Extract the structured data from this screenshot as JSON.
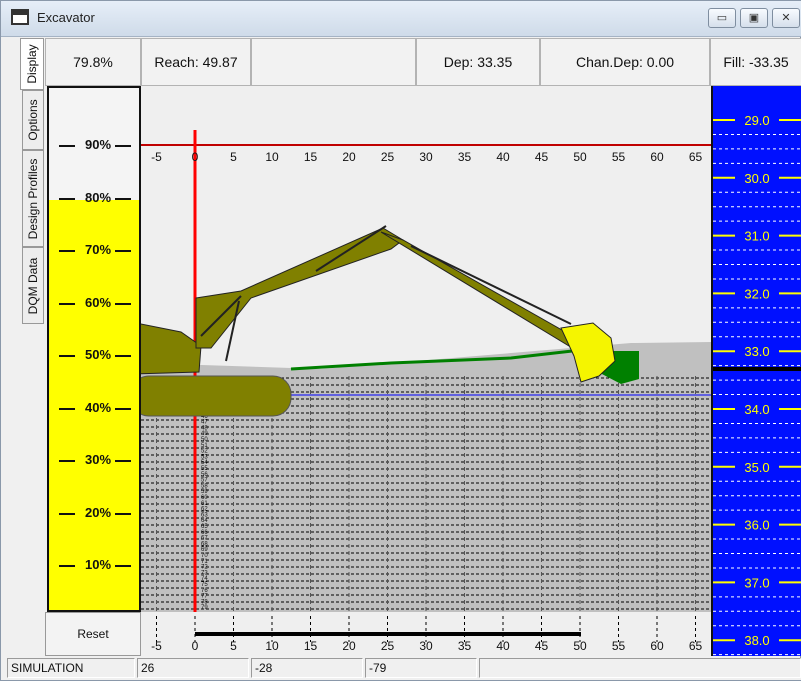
{
  "window": {
    "title": "Excavator",
    "minimize": "▭",
    "maximize": "▣",
    "close": "✕"
  },
  "tabs": [
    {
      "label": "Display",
      "active": true
    },
    {
      "label": "Options",
      "active": false
    },
    {
      "label": "Design Profiles",
      "active": false
    },
    {
      "label": "DQM Data",
      "active": false
    }
  ],
  "header": {
    "percent": "79.8%",
    "reach": "Reach: 49.87",
    "dep": "Dep: 33.35",
    "chan_dep": "Chan.Dep: 0.00",
    "fill": "Fill: -33.35"
  },
  "fill_gauge": {
    "level_percent": 79.8,
    "ticks": [
      "90%",
      "80%",
      "70%",
      "60%",
      "50%",
      "40%",
      "30%",
      "20%",
      "10%"
    ],
    "fill_color": "#ffff00"
  },
  "depth_gauge": {
    "labels": [
      "29.0",
      "30.0",
      "31.0",
      "32.0",
      "33.0",
      "34.0",
      "35.0",
      "36.0",
      "37.0",
      "38.0"
    ],
    "color": "#0010ff"
  },
  "profile": {
    "top_scale": [
      "-5",
      "0",
      "5",
      "10",
      "15",
      "20",
      "25",
      "30",
      "35",
      "40",
      "45",
      "50",
      "55",
      "60",
      "65"
    ],
    "bottom_scale": [
      "-5",
      "0",
      "5",
      "10",
      "15",
      "20",
      "25",
      "30",
      "35",
      "40",
      "45",
      "50",
      "55",
      "60",
      "65"
    ],
    "depth_marks": [
      "40",
      "41",
      "42",
      "43",
      "44",
      "45",
      "46",
      "47",
      "48",
      "49",
      "50",
      "51",
      "52",
      "53",
      "54",
      "55",
      "56",
      "57",
      "58",
      "59",
      "60",
      "61",
      "62",
      "63",
      "64",
      "65",
      "66",
      "67",
      "68",
      "69",
      "70",
      "71",
      "72",
      "73",
      "74",
      "75",
      "76",
      "77",
      "78",
      "79"
    ],
    "excavator_color": "#808000",
    "bucket_color": "#f5f500",
    "fill_color": "#008000",
    "ground_color": "#c0c0c0"
  },
  "reset_label": "Reset",
  "status": {
    "mode": "SIMULATION",
    "x": "26",
    "y": "-28",
    "z": "-79"
  }
}
